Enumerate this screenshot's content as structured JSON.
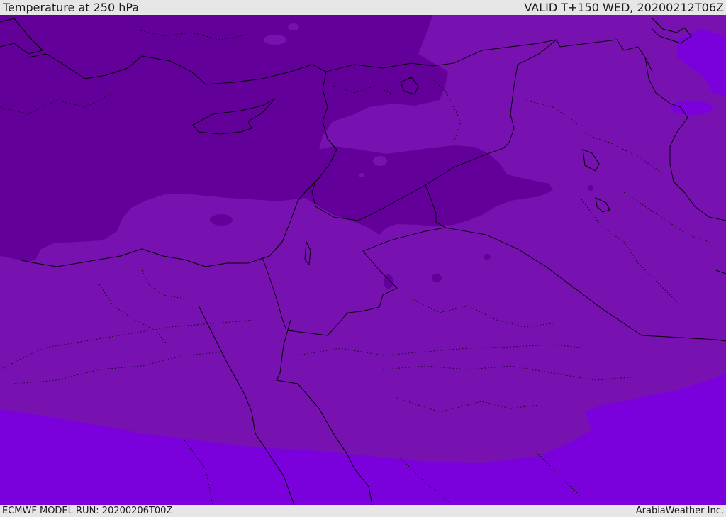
{
  "header": {
    "title": "Temperature at 250 hPa",
    "valid_time": "VALID T+150 WED, 20200212T06Z"
  },
  "footer": {
    "model_run": "ECMWF MODEL RUN: 20200206T00Z",
    "credit": "ArabiaWeather Inc."
  },
  "map": {
    "colors": {
      "coldest": "#63009a",
      "cold": "#7711b0",
      "mild": "#7a00dc",
      "coast_line": "#000000",
      "border_line": "#000000"
    }
  }
}
